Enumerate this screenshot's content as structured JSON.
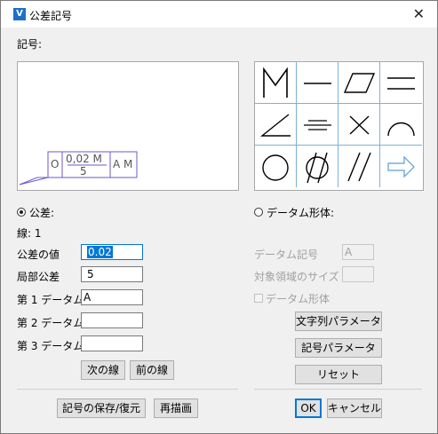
{
  "window": {
    "title": "公差記号",
    "app_icon": "app-icon"
  },
  "symbol_label": "記号:",
  "preview": {
    "frame_text_top": "0,02 M",
    "frame_text_bottom": "5",
    "frame_circle": "O",
    "datum_text": "A M"
  },
  "symbol_grid_icons": [
    "max-material-icon",
    "straightness-icon",
    "flatness-icon",
    "parallel-lines-icon",
    "angularity-icon",
    "symmetry-icon",
    "cross-icon",
    "arc-profile-icon",
    "circularity-icon",
    "cylindricity-icon",
    "double-slash-icon",
    "arrow-icon"
  ],
  "tolerance_section": {
    "radio_label": "公差:",
    "line_label": "線: 1",
    "value_label": "公差の値",
    "value": "0.02",
    "local_label": "局部公差",
    "local_value": "5",
    "datum1_label": "第 1 データム",
    "datum1_value": "A",
    "datum2_label": "第 2 データム",
    "datum2_value": "",
    "datum3_label": "第 3 データム",
    "datum3_value": "",
    "next_line": "次の線",
    "prev_line": "前の線"
  },
  "datum_section": {
    "radio_label": "データム形体:",
    "datum_symbol_label": "データム記号",
    "datum_symbol_value": "A",
    "target_size_label": "対象領域のサイズ",
    "target_size_value": "",
    "datum_feature_check": "データム形体",
    "string_params": "文字列パラメータ",
    "symbol_params": "記号パラメータ",
    "reset": "リセット"
  },
  "footer": {
    "save_restore": "記号の保存/復元",
    "redraw": "再描画",
    "ok": "OK",
    "cancel": "キャンセル"
  }
}
